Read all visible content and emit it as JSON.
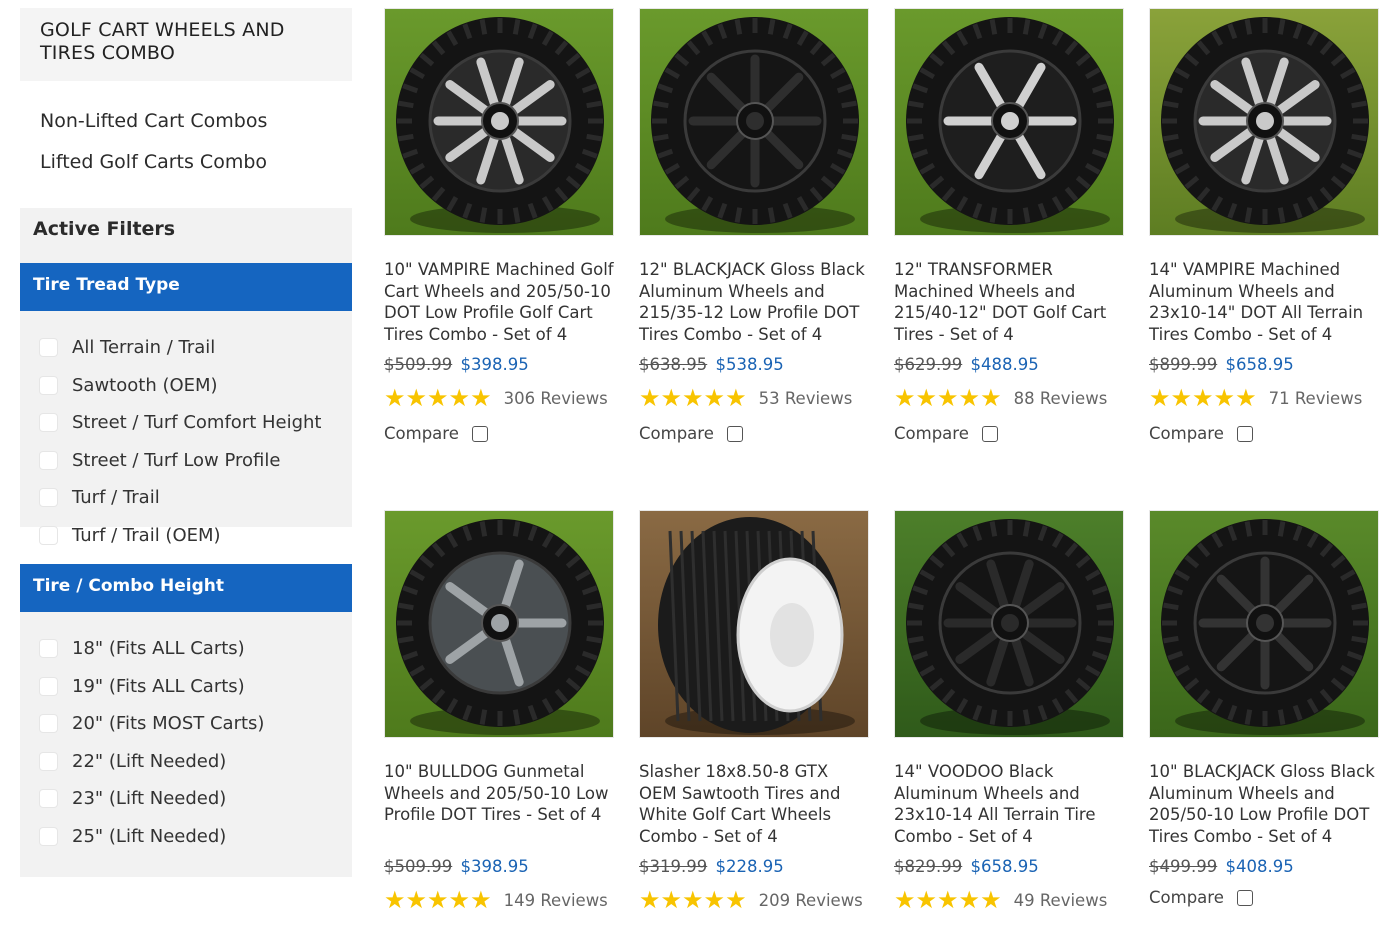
{
  "sidebar": {
    "category_title": "GOLF CART WHEELS AND TIRES COMBO",
    "subcategories": [
      "Non-Lifted Cart Combos",
      "Lifted Golf Carts Combo"
    ],
    "active_filters_title": "Active Filters",
    "filters": [
      {
        "title": "Tire Tread Type",
        "options": [
          "All Terrain / Trail",
          "Sawtooth (OEM)",
          "Street / Turf Comfort Height",
          "Street / Turf Low Profile",
          "Turf / Trail",
          "Turf / Trail (OEM)"
        ]
      },
      {
        "title": "Tire / Combo Height",
        "options": [
          "18\" (Fits ALL Carts)",
          "19\" (Fits ALL Carts)",
          "20\" (Fits MOST Carts)",
          "22\" (Lift Needed)",
          "23\" (Lift Needed)",
          "25\" (Lift Needed)"
        ]
      }
    ]
  },
  "colors": {
    "accent": "#1565c0",
    "price": "#1a63b4",
    "star": "#f8c400",
    "panel": "#f2f2f2"
  },
  "products": [
    {
      "title": "10\" VAMPIRE Machined Golf Cart Wheels and 205/50-10 DOT Low Profile Golf Cart Tires Combo - Set of 4",
      "old_price": "$509.99",
      "new_price": "$398.95",
      "rating": 5,
      "stars": "★★★★★",
      "reviews": "306 Reviews",
      "compare": "Compare",
      "image": "vampire-machined-wheel",
      "bg": "grass"
    },
    {
      "title": "12\" BLACKJACK Gloss Black Aluminum Wheels and 215/35-12 Low Profile DOT Tires Combo - Set of 4",
      "old_price": "$638.95",
      "new_price": "$538.95",
      "rating": 5,
      "stars": "★★★★★",
      "reviews": "53 Reviews",
      "compare": "Compare",
      "image": "blackjack-black-wheel",
      "bg": "grass"
    },
    {
      "title": "12\" TRANSFORMER Machined Wheels and 215/40-12\" DOT Golf Cart Tires - Set of 4",
      "old_price": "$629.99",
      "new_price": "$488.95",
      "rating": 5,
      "stars": "★★★★★",
      "reviews": "88 Reviews",
      "compare": "Compare",
      "image": "transformer-machined-wheel",
      "bg": "grass"
    },
    {
      "title": "14\" VAMPIRE Machined Aluminum Wheels and 23x10-14\" DOT All Terrain Tires Combo - Set of 4",
      "old_price": "$899.99",
      "new_price": "$658.95",
      "rating": 5,
      "stars": "★★★★★",
      "reviews": "71 Reviews",
      "compare": "Compare",
      "image": "vampire-all-terrain-wheel",
      "bg": "grass-warm"
    },
    {
      "title": "10\" BULLDOG Gunmetal Wheels and 205/50-10 Low Profile DOT Tires - Set of 4",
      "old_price": "$509.99",
      "new_price": "$398.95",
      "rating": 5,
      "stars": "★★★★★",
      "reviews": "149 Reviews",
      "compare": "",
      "image": "bulldog-gunmetal-wheel",
      "bg": "grass"
    },
    {
      "title": "Slasher 18x8.50-8 GTX OEM Sawtooth Tires and White Golf Cart Wheels Combo - Set of 4",
      "old_price": "$319.99",
      "new_price": "$228.95",
      "rating": 5,
      "stars": "★★★★★",
      "reviews": "209 Reviews",
      "compare": "",
      "image": "sawtooth-white-wheel",
      "bg": "dirt"
    },
    {
      "title": "14\" VOODOO Black Aluminum Wheels and 23x10-14 All Terrain Tire Combo - Set of 4",
      "old_price": "$829.99",
      "new_price": "$658.95",
      "rating": 5,
      "stars": "★★★★★",
      "reviews": "49 Reviews",
      "compare": "",
      "image": "voodoo-black-wheel",
      "bg": "grass-blue"
    },
    {
      "title": "10\" BLACKJACK Gloss Black Aluminum Wheels and 205/50-10 Low Profile DOT Tires Combo - Set of 4",
      "old_price": "$499.99",
      "new_price": "$408.95",
      "rating": 0,
      "stars": "",
      "reviews": "",
      "compare": "Compare",
      "image": "blackjack-10-black-wheel",
      "bg": "grass-dark"
    }
  ]
}
